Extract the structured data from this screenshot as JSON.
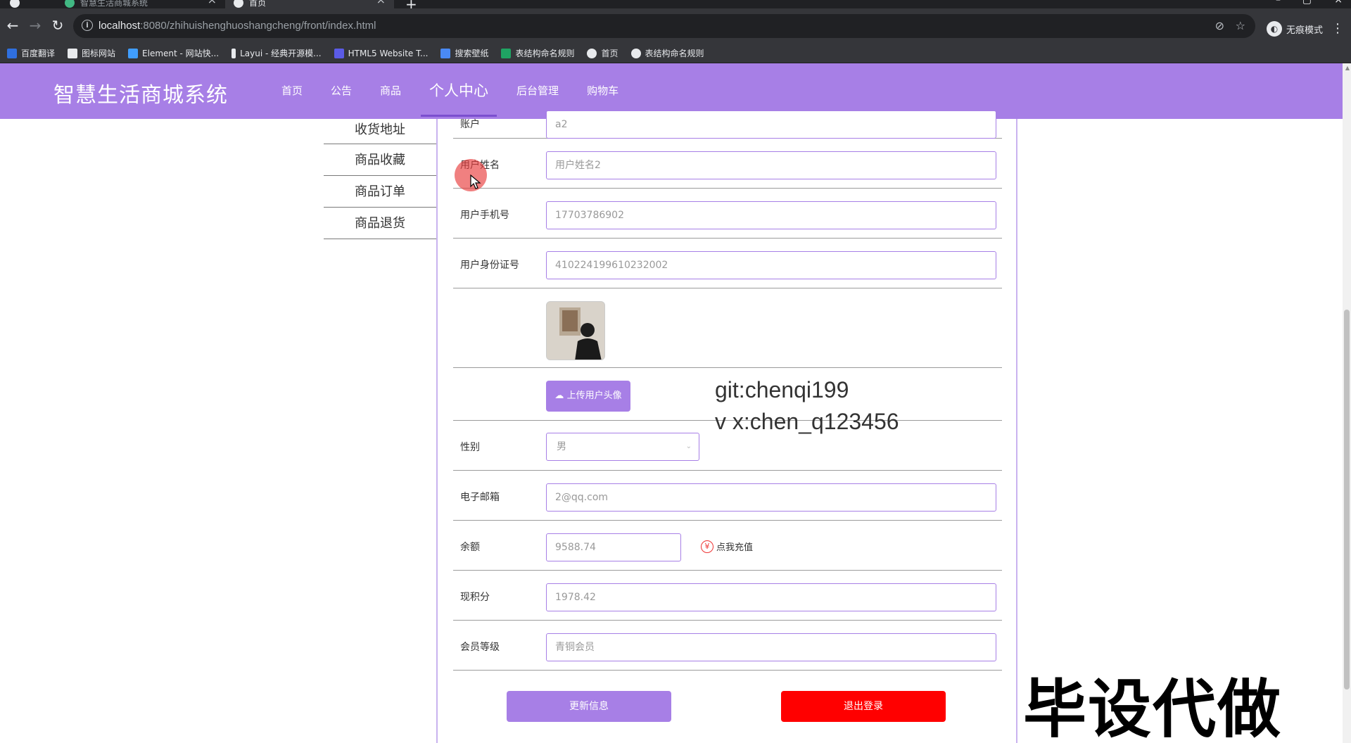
{
  "browser": {
    "tabs": [
      {
        "title": "智慧生活商城系统",
        "active": false
      },
      {
        "title": "首页",
        "active": true
      }
    ],
    "url_host": "localhost",
    "url_path": ":8080/zhihuishenghuoshangcheng/front/index.html",
    "incognito_label": "无痕模式",
    "bookmarks": [
      {
        "label": "百度翻译",
        "icon": "translate-icon",
        "color": "#2f6fde"
      },
      {
        "label": "图标网站",
        "icon": "flag-icon",
        "color": "#e8eaed"
      },
      {
        "label": "Element - 网站快...",
        "icon": "element-icon",
        "color": "#409eff"
      },
      {
        "label": "Layui - 经典开源模...",
        "icon": "layui-icon",
        "color": "#e8eaed"
      },
      {
        "label": "HTML5 Website T...",
        "icon": "html5-icon",
        "color": "#5b5be6"
      },
      {
        "label": "搜索壁纸",
        "icon": "wallpaper-icon",
        "color": "#4a8af4"
      },
      {
        "label": "表结构命名规则",
        "icon": "sheet-icon",
        "color": "#1fa463"
      },
      {
        "label": "首页",
        "icon": "globe-icon",
        "color": "#e8eaed"
      },
      {
        "label": "表结构命名规则",
        "icon": "globe-icon",
        "color": "#e8eaed"
      }
    ]
  },
  "site": {
    "title": "智慧生活商城系统",
    "nav": [
      "首页",
      "公告",
      "商品",
      "个人中心",
      "后台管理",
      "购物车"
    ],
    "active_nav": "个人中心"
  },
  "side_menu": [
    "收货地址",
    "商品收藏",
    "商品订单",
    "商品退货"
  ],
  "form": {
    "account_label": "账户",
    "account_value": "a2",
    "name_label": "用户姓名",
    "name_value": "用户姓名2",
    "phone_label": "用户手机号",
    "phone_value": "17703786902",
    "idcard_label": "用户身份证号",
    "idcard_value": "410224199610232002",
    "upload_button": "上传用户头像",
    "gender_label": "性别",
    "gender_value": "男",
    "email_label": "电子邮箱",
    "email_value": "2@qq.com",
    "balance_label": "余额",
    "balance_value": "9588.74",
    "recharge_label": "点我充值",
    "points_label": "现积分",
    "points_value": "1978.42",
    "level_label": "会员等级",
    "level_value": "青铜会员",
    "update_button": "更新信息",
    "logout_button": "退出登录"
  },
  "overlay": {
    "git_line": "git:chenqi199",
    "wx_line": "v x:chen_q123456",
    "watermark": "毕设代做"
  },
  "colors": {
    "brand": "#a77fe6",
    "danger": "#ff0000"
  }
}
